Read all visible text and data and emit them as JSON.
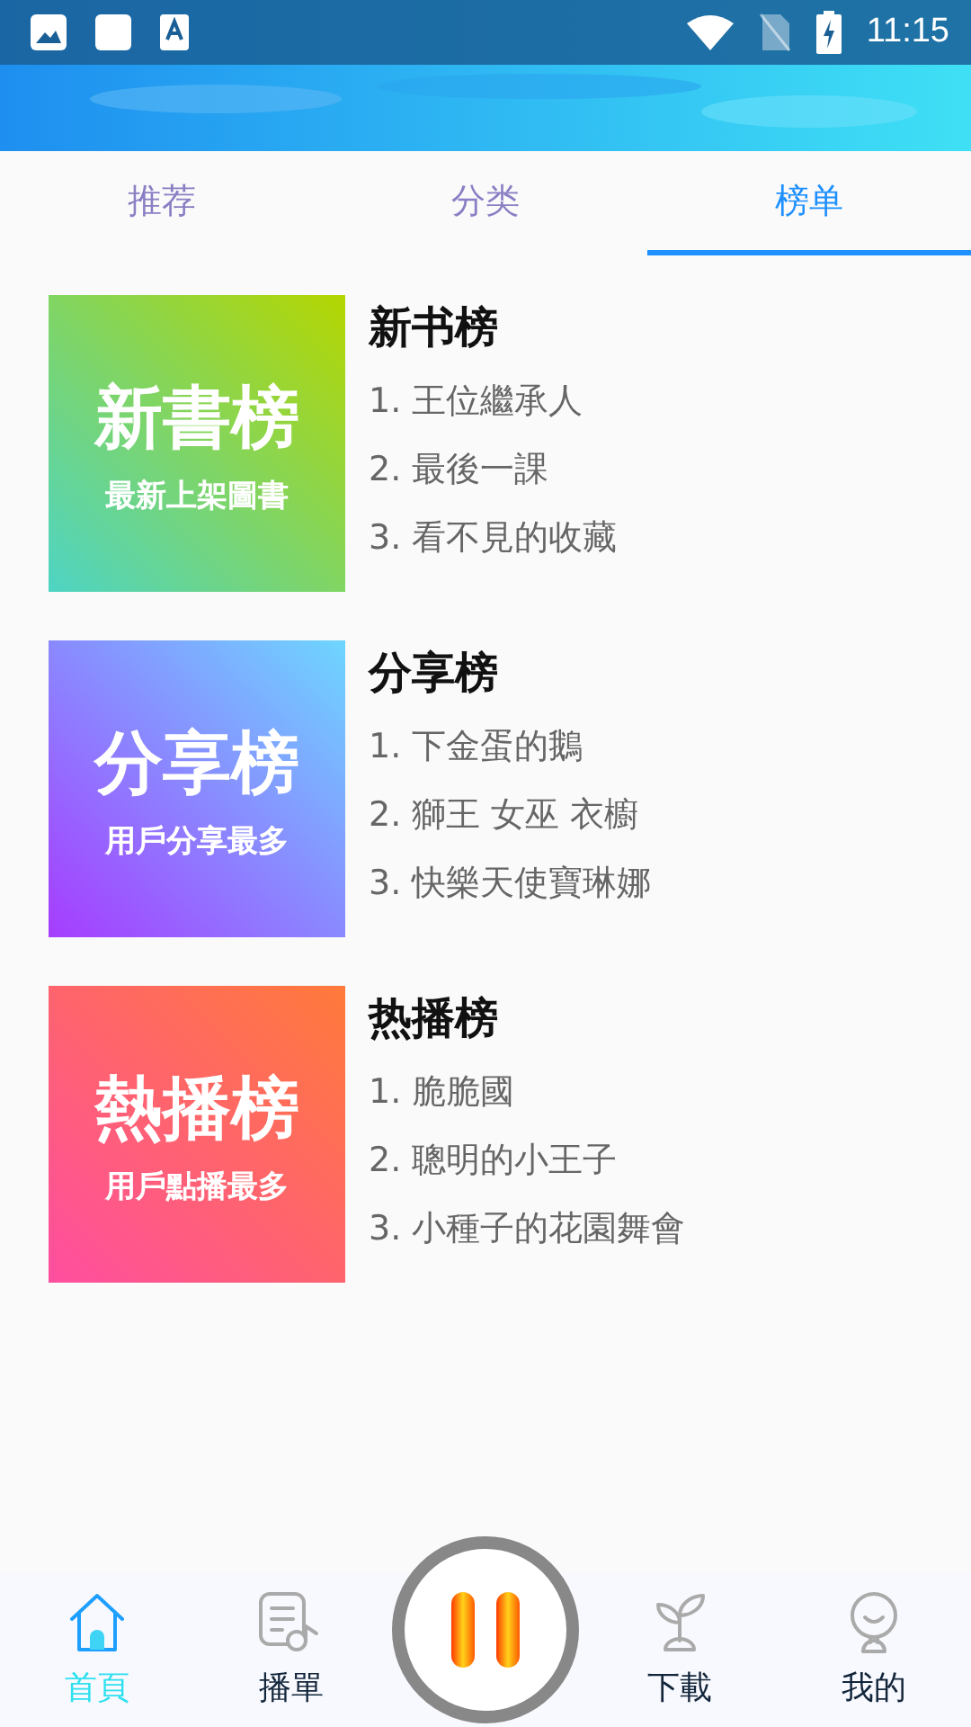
{
  "status_bar": {
    "time": "11:15"
  },
  "tabs": [
    {
      "label": "推荐",
      "selected": false
    },
    {
      "label": "分类",
      "selected": false
    },
    {
      "label": "榜单",
      "selected": true
    }
  ],
  "charts": [
    {
      "title": "新书榜",
      "cover_title": "新書榜",
      "cover_subtitle": "最新上架圖書",
      "entries": [
        "1. 王位繼承人",
        "2. 最後一課",
        "3. 看不見的收藏"
      ]
    },
    {
      "title": "分享榜",
      "cover_title": "分享榜",
      "cover_subtitle": "用戶分享最多",
      "entries": [
        "1. 下金蛋的鵝",
        "2. 獅王 女巫 衣櫥",
        "3. 快樂天使寶琳娜"
      ]
    },
    {
      "title": "热播榜",
      "cover_title": "熱播榜",
      "cover_subtitle": "用戶點播最多",
      "entries": [
        "1. 脆脆國",
        "2. 聰明的小王子",
        "3. 小種子的花園舞會"
      ]
    }
  ],
  "bottom_nav": [
    {
      "label": "首頁",
      "kind": "home",
      "selected": true
    },
    {
      "label": "播單",
      "kind": "playlist",
      "selected": false
    },
    {
      "kind": "player",
      "playing": true
    },
    {
      "label": "下載",
      "kind": "download",
      "selected": false
    },
    {
      "label": "我的",
      "kind": "profile",
      "selected": false
    }
  ]
}
